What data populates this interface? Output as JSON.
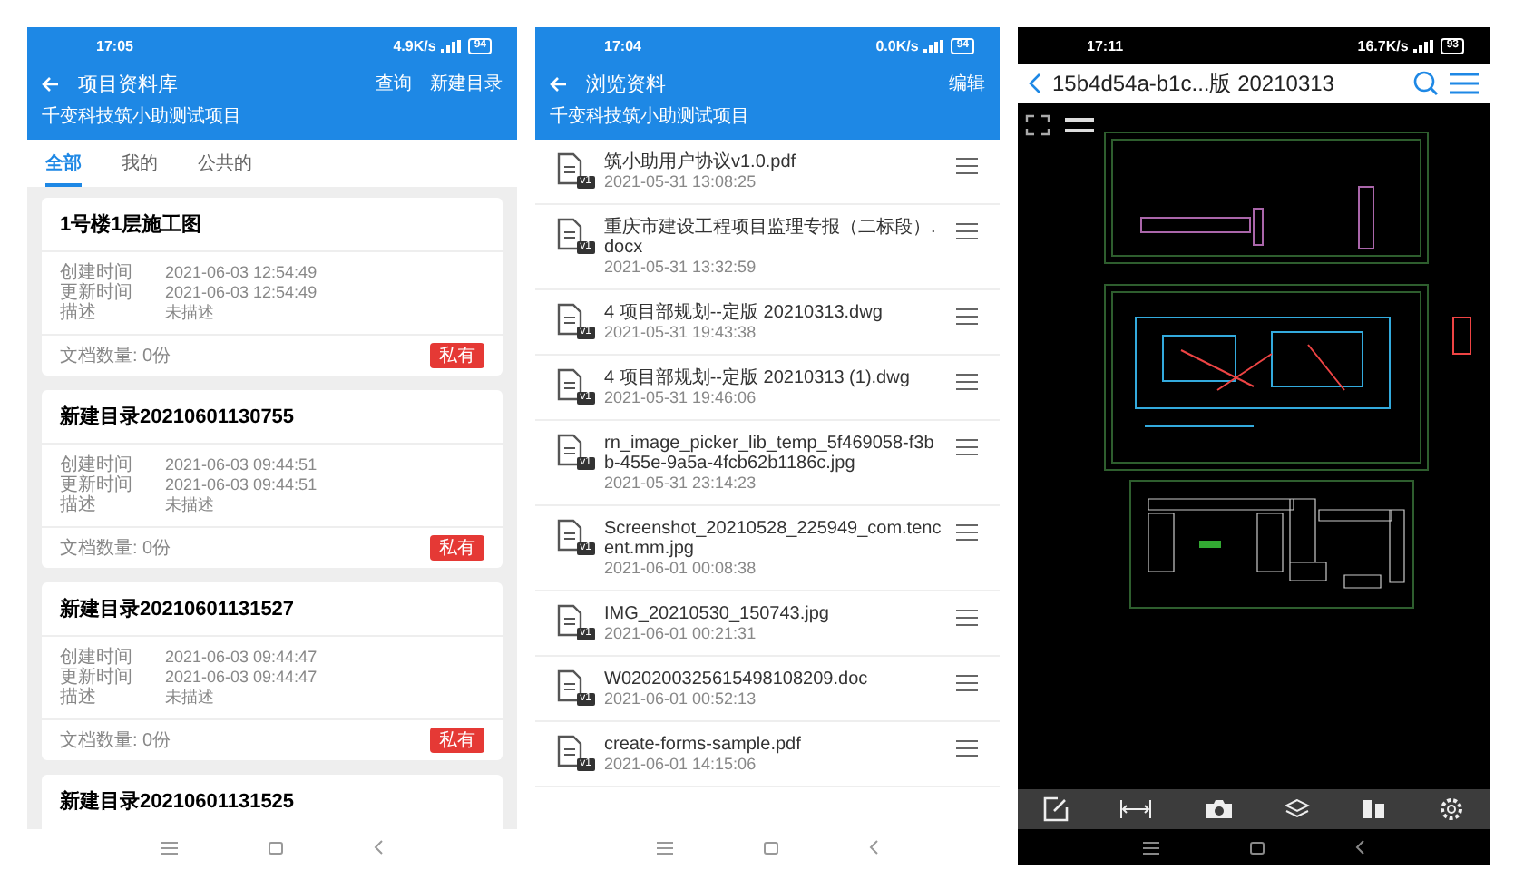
{
  "phones": [
    {
      "kind": "library",
      "status": {
        "time": "17:05",
        "speed": "4.9K/s",
        "battery": "94"
      },
      "header": {
        "title": "项目资料库",
        "actions": [
          "查询",
          "新建目录"
        ],
        "subtitle": "千变科技筑小助测试项目"
      },
      "tabs": [
        {
          "label": "全部",
          "selected": true
        },
        {
          "label": "我的",
          "selected": false
        },
        {
          "label": "公共的",
          "selected": false
        }
      ],
      "cards": [
        {
          "title": "1号楼1层施工图",
          "details": [
            {
              "label": "创建时间",
              "value": "2021-06-03 12:54:49"
            },
            {
              "label": "更新时间",
              "value": "2021-06-03 12:54:49"
            },
            {
              "label": "描述",
              "value": "未描述"
            }
          ],
          "count": "文档数量: 0份",
          "tag": "私有"
        },
        {
          "title": "新建目录20210601130755",
          "details": [
            {
              "label": "创建时间",
              "value": "2021-06-03 09:44:51"
            },
            {
              "label": "更新时间",
              "value": "2021-06-03 09:44:51"
            },
            {
              "label": "描述",
              "value": "未描述"
            }
          ],
          "count": "文档数量: 0份",
          "tag": "私有"
        },
        {
          "title": "新建目录20210601131527",
          "details": [
            {
              "label": "创建时间",
              "value": "2021-06-03 09:44:47"
            },
            {
              "label": "更新时间",
              "value": "2021-06-03 09:44:47"
            },
            {
              "label": "描述",
              "value": "未描述"
            }
          ],
          "count": "文档数量: 0份",
          "tag": "私有"
        },
        {
          "title": "新建目录20210601131525"
        }
      ]
    },
    {
      "kind": "files",
      "status": {
        "time": "17:04",
        "speed": "0.0K/s",
        "battery": "94"
      },
      "header": {
        "title": "浏览资料",
        "actions": [
          "编辑"
        ],
        "subtitle": "千变科技筑小助测试项目"
      },
      "files": [
        {
          "name": "筑小助用户协议v1.0.pdf",
          "date": "2021-05-31 13:08:25",
          "version": "v1"
        },
        {
          "name": "重庆市建设工程项目监理专报（二标段）.docx",
          "date": "2021-05-31 13:32:59",
          "version": "v1"
        },
        {
          "name": "4 项目部规划--定版  20210313.dwg",
          "date": "2021-05-31 19:43:38",
          "version": "v1"
        },
        {
          "name": "4 项目部规划--定版  20210313 (1).dwg",
          "date": "2021-05-31 19:46:06",
          "version": "v1"
        },
        {
          "name": "rn_image_picker_lib_temp_5f469058-f3bb-455e-9a5a-4fcb62b1186c.jpg",
          "date": "2021-05-31 23:14:23",
          "version": "v1"
        },
        {
          "name": "Screenshot_20210528_225949_com.tencent.mm.jpg",
          "date": "2021-06-01 00:08:38",
          "version": "v1"
        },
        {
          "name": "IMG_20210530_150743.jpg",
          "date": "2021-06-01 00:21:31",
          "version": "v1"
        },
        {
          "name": "W020200325615498108209.doc",
          "date": "2021-06-01 00:52:13",
          "version": "v1"
        },
        {
          "name": "create-forms-sample.pdf",
          "date": "2021-06-01 14:15:06",
          "version": "v1"
        }
      ]
    },
    {
      "kind": "viewer",
      "status": {
        "time": "17:11",
        "speed": "16.7K/s",
        "battery": "93"
      },
      "header": {
        "title": "15b4d54a-b1c...版  20210313"
      }
    }
  ]
}
